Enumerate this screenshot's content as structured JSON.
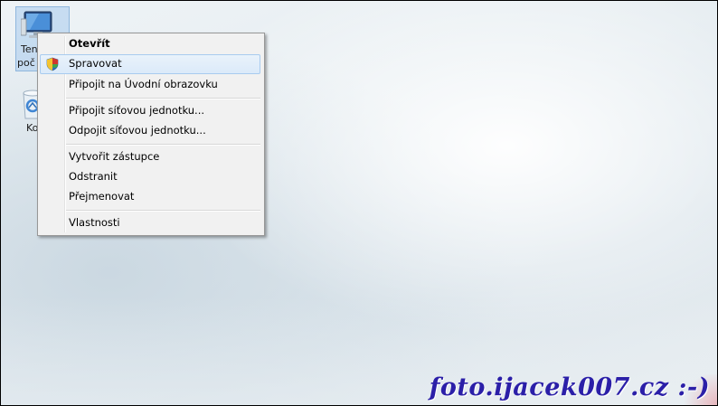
{
  "desktop": {
    "icons": [
      {
        "label_line1": "Ten",
        "label_line2": "poč",
        "icon": "computer-icon",
        "selected": true
      },
      {
        "label_line1": "Ko",
        "icon": "recycle-bin-icon",
        "selected": false
      }
    ]
  },
  "context_menu": {
    "items": {
      "open": "Otevřít",
      "manage": "Spravovat",
      "pin_start": "Připojit na Úvodní obrazovku",
      "map_drive": "Připojit síťovou jednotku...",
      "disconnect_drive": "Odpojit síťovou jednotku...",
      "create_shortcut": "Vytvořit zástupce",
      "delete": "Odstranit",
      "rename": "Přejmenovat",
      "properties": "Vlastnosti"
    },
    "hovered_item": "manage",
    "manage_icon": "uac-shield-icon"
  },
  "watermark": {
    "text": "foto.ijacek007.cz :-)"
  },
  "colors": {
    "watermark": "#2b1fa8",
    "menu_bg": "#f1f1f1",
    "hover_border": "#a8cbef",
    "selection_tile": "#a8caec"
  }
}
